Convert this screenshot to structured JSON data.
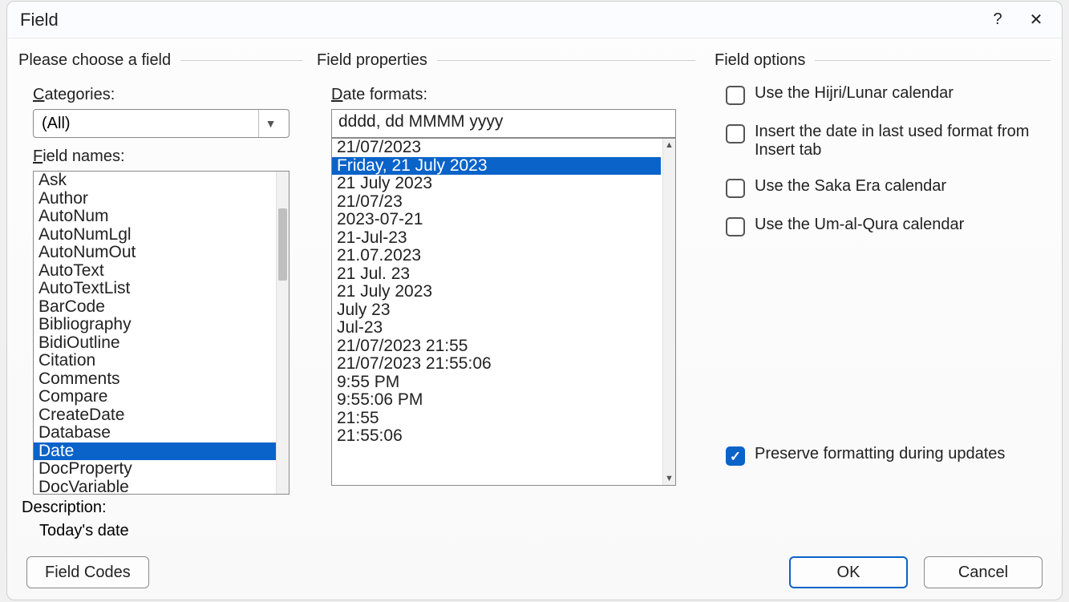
{
  "dialog": {
    "title": "Field",
    "help_icon": "?",
    "close_icon": "✕"
  },
  "left": {
    "section": "Please choose a field",
    "categories_label_pre": "",
    "categories_label_u": "C",
    "categories_label_post": "ategories:",
    "categories_value": "(All)",
    "fieldnames_label_pre": "",
    "fieldnames_label_u": "F",
    "fieldnames_label_post": "ield names:",
    "items": [
      "Ask",
      "Author",
      "AutoNum",
      "AutoNumLgl",
      "AutoNumOut",
      "AutoText",
      "AutoTextList",
      "BarCode",
      "Bibliography",
      "BidiOutline",
      "Citation",
      "Comments",
      "Compare",
      "CreateDate",
      "Database",
      "Date",
      "DocProperty",
      "DocVariable"
    ],
    "selected_index": 15
  },
  "mid": {
    "section": "Field properties",
    "formats_label_pre": "",
    "formats_label_u": "D",
    "formats_label_post": "ate formats:",
    "format_value": "dddd, dd MMMM yyyy",
    "items": [
      "21/07/2023",
      "Friday, 21 July 2023",
      "21 July 2023",
      "21/07/23",
      "2023-07-21",
      "21-Jul-23",
      "21.07.2023",
      "21 Jul. 23",
      "21 July 2023",
      "July 23",
      "Jul-23",
      "21/07/2023 21:55",
      "21/07/2023 21:55:06",
      "9:55 PM",
      "9:55:06 PM",
      "21:55",
      "21:55:06"
    ],
    "selected_index": 1
  },
  "right": {
    "section": "Field options",
    "opt_hijri_pre": "Use the ",
    "opt_hijri_u": "H",
    "opt_hijri_post": "ijri/Lunar calendar",
    "opt_last_pre": "Insert the date in ",
    "opt_last_u": "l",
    "opt_last_post": "ast used format from Insert tab",
    "opt_saka_pre": "Use the ",
    "opt_saka_u": "S",
    "opt_saka_post": "aka Era calendar",
    "opt_umal_pre": "Use the ",
    "opt_umal_u": "U",
    "opt_umal_post": "m-al-Qura calendar",
    "preserve_pre": "Preser",
    "preserve_u": "v",
    "preserve_post": "e formatting during updates"
  },
  "description": {
    "label": "Description:",
    "value": "Today's date"
  },
  "footer": {
    "field_codes": "Field Codes",
    "ok": "OK",
    "cancel": "Cancel"
  }
}
